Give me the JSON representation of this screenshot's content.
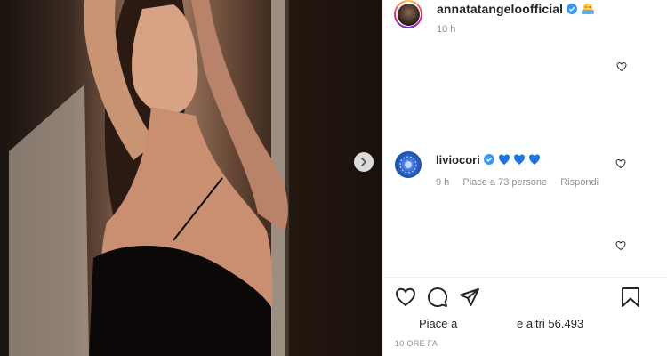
{
  "post": {
    "author": "annatatangeloofficial",
    "age": "10 h",
    "timestamp": "10 ORE FA"
  },
  "comment": {
    "user": "liviocori",
    "age": "9 h",
    "likes_text": "Piace a 73 persone",
    "reply_label": "Rispondi"
  },
  "likes": {
    "prefix": "Piace a",
    "suffix": "e altri 56.493"
  },
  "colors": {
    "verified": "#3897f0",
    "heart_blue": "#1e73e8",
    "muted": "#8e8e8e"
  }
}
